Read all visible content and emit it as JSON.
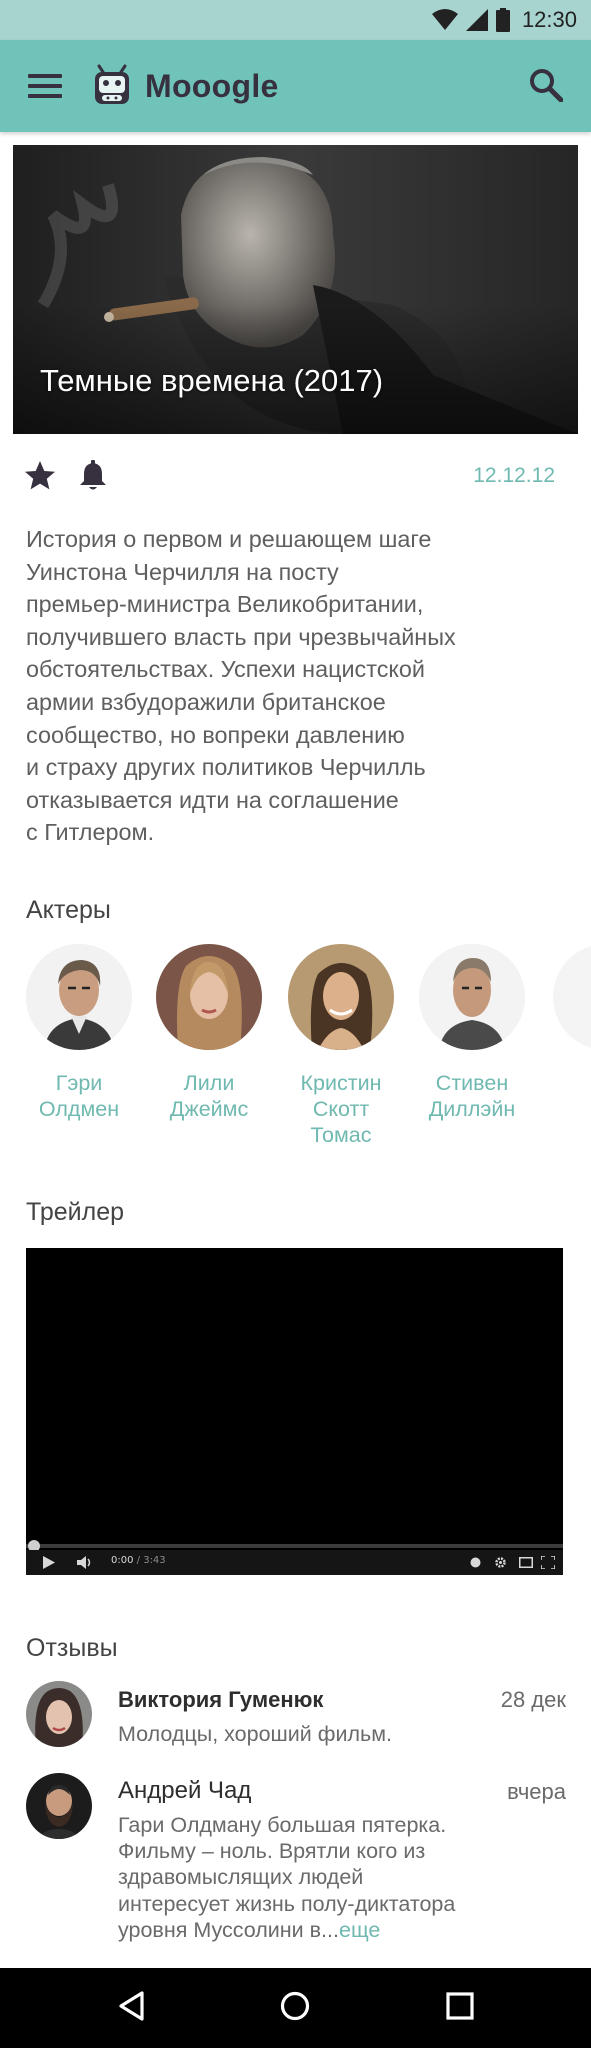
{
  "status_bar": {
    "time": "12:30",
    "icons": [
      "wifi-icon",
      "signal-icon",
      "battery-icon"
    ]
  },
  "app_bar": {
    "title": "Mooogle",
    "icons": [
      "menu-icon",
      "app-logo-icon",
      "search-icon"
    ]
  },
  "movie": {
    "title": "Темные времена (2017)",
    "date": "12.12.12",
    "actions": [
      "star-icon",
      "bell-icon"
    ],
    "description_lines": [
      "История о первом и решающем шаге",
      "Уинстона Черчилля на посту",
      "премьер-министра Великобритании,",
      "получившего власть при чрезвычайных",
      "обстоятельствах. Успехи нацистской",
      "армии взбудоражили британское",
      "сообщество, но вопреки давлению",
      "и страху других политиков Черчилль",
      "отказывается идти на соглашение",
      "с Гитлером."
    ]
  },
  "actors": {
    "title": "Актеры",
    "items": [
      {
        "name_lines": [
          "Гэри",
          "Олдмен"
        ]
      },
      {
        "name_lines": [
          "Лили",
          "Джеймс"
        ]
      },
      {
        "name_lines": [
          "Кристин",
          "Скотт",
          "Томас"
        ]
      },
      {
        "name_lines": [
          "Стивен",
          "Диллэйн"
        ]
      }
    ]
  },
  "trailer": {
    "title": "Трейлер",
    "time_current": "0:00",
    "time_total": "/ 3:43",
    "progress": 0
  },
  "reviews": {
    "title": "Отзывы",
    "items": [
      {
        "author": "Виктория Гуменюк",
        "date": "28 дек",
        "text_lines": [
          "Молодцы, хороший фильм."
        ]
      },
      {
        "author": "Андрей Чад",
        "date": "вчера",
        "text_lines": [
          "Гари Олдману большая пятерка.",
          "Фильму – ноль. Врятли кого из",
          "здравомыслящих людей",
          "интересует жизнь полу-диктатора",
          "уровня Муссолини в..."
        ],
        "more_label": "еще"
      }
    ]
  },
  "colors": {
    "status_bar": "#a7d4cf",
    "app_bar": "#6fc3b9",
    "accent_text": "#6fb9b0",
    "icon_dark": "#37303f"
  },
  "nav_bar": {
    "icons": [
      "back-icon",
      "home-icon",
      "recents-icon"
    ]
  }
}
